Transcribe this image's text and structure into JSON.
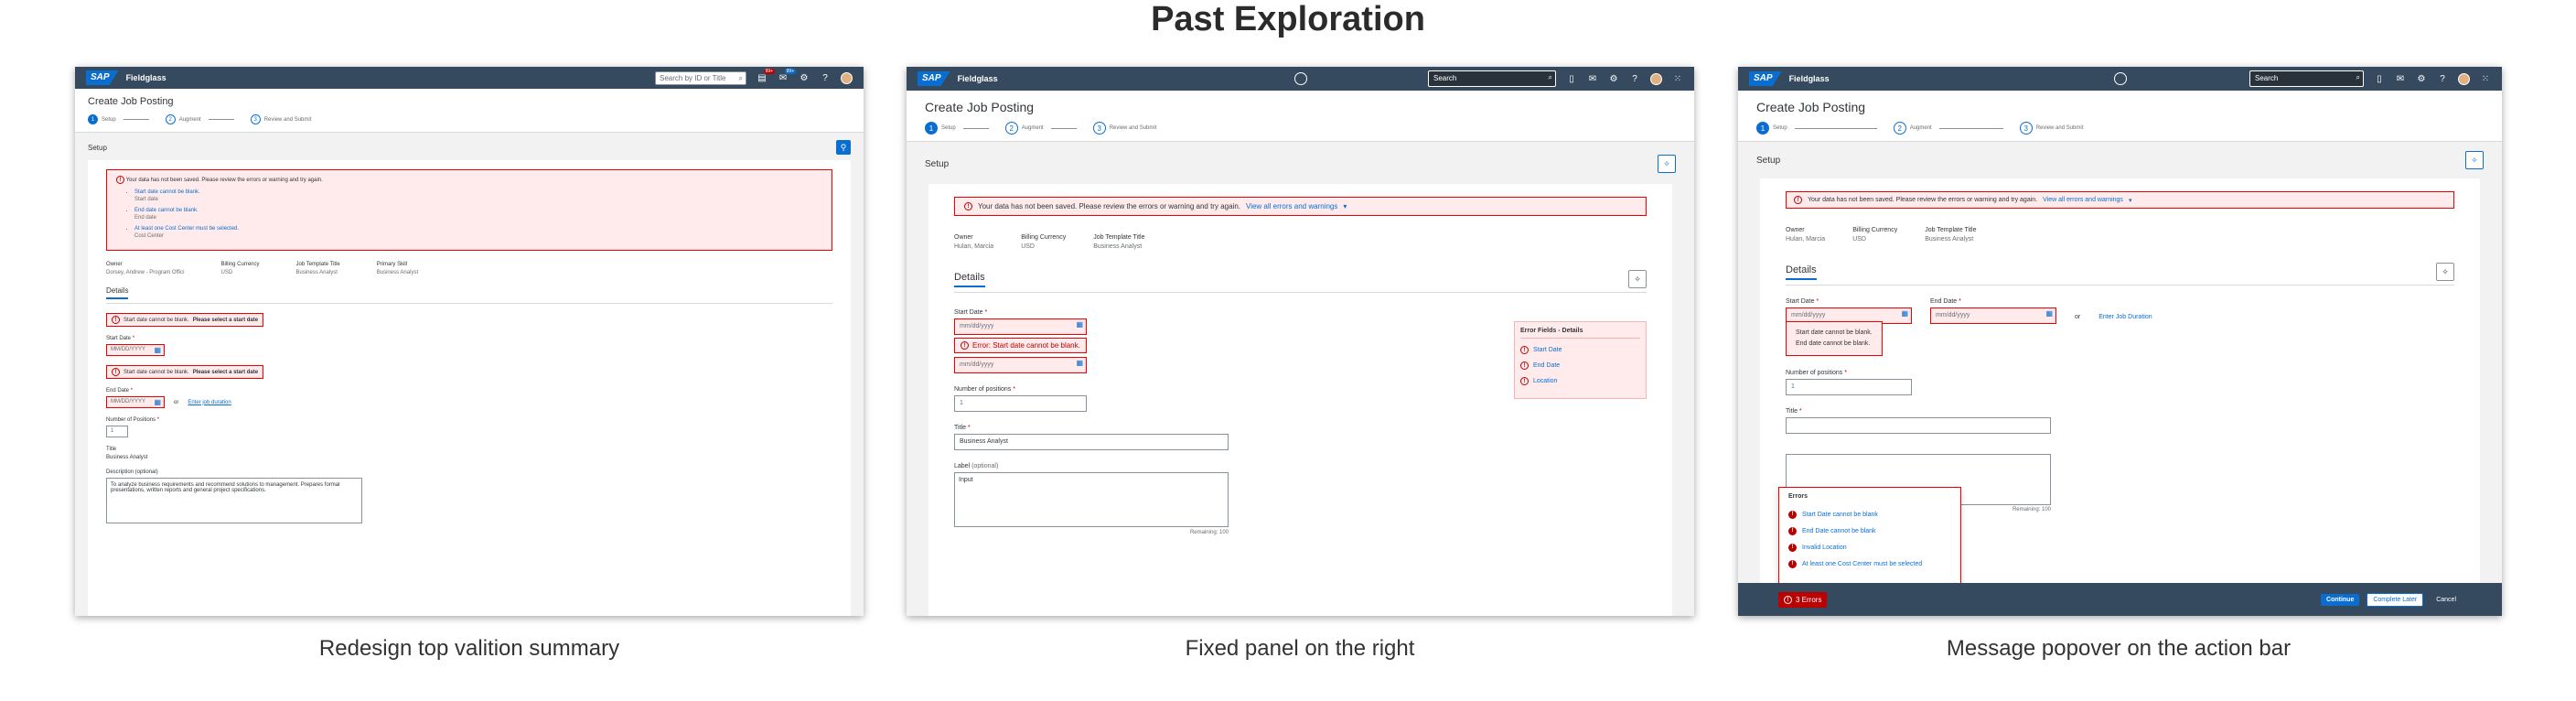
{
  "title": "Past Exploration",
  "common": {
    "sap_logo": "SAP",
    "product": "Fieldglass",
    "page_title": "Create Job Posting",
    "steps": [
      {
        "num": "1",
        "label": "Setup"
      },
      {
        "num": "2",
        "label": "Augment"
      },
      {
        "num": "3",
        "label": "Review and Submit"
      }
    ],
    "section_title": "Setup",
    "details_tab": "Details",
    "search_placeholder": "Search"
  },
  "variant1": {
    "caption": "Redesign top valition summary",
    "search_placeholder": "Search by ID or Title",
    "notif_badge": "99+",
    "msg_badge": "99+",
    "error_header": "Your data has not been saved. Please review the errors or warning and try again.",
    "errors": [
      {
        "text": "Start date cannot be blank.",
        "field": "Start date"
      },
      {
        "text": "End date cannot be blank.",
        "field": "End date"
      },
      {
        "text": "At least one Cost Center must be selected.",
        "field": "Cost Center"
      }
    ],
    "meta": [
      {
        "label": "Owner",
        "value": "Dorsey, Andrew - Program Offici"
      },
      {
        "label": "Billing Currency",
        "value": "USD"
      },
      {
        "label": "Job Template Title",
        "value": "Business Analyst"
      },
      {
        "label": "Primary Skill",
        "value": "Business Analyst"
      }
    ],
    "inline_err_msg": "Start date cannot be blank.",
    "inline_err_hint": "Please select a start date",
    "start_label": "Start Date",
    "end_label": "End Date",
    "date_placeholder": "MM/DD/YYYY",
    "or": "or",
    "enter_duration": "Enter job duration",
    "positions_label": "Number of Positions",
    "positions_value": "1",
    "title_label": "Title",
    "title_value": "Business Analyst",
    "desc_label": "Description (optional)",
    "desc_value": "To analyze business requirements and recommend solutions to management. Prepares formal presentations, written reports and general project specifications."
  },
  "variant2": {
    "caption": "Fixed panel on the right",
    "error_header": "Your data has not been saved. Please review the errors or warning and try again.",
    "view_all": "View all errors and warnings",
    "meta": [
      {
        "label": "Owner",
        "value": "Hulan, Marcia"
      },
      {
        "label": "Billing Currency",
        "value": "USD"
      },
      {
        "label": "Job Template Title",
        "value": "Business Analyst"
      }
    ],
    "start_label": "Start Date",
    "date_placeholder": "mm/dd/yyyy",
    "inline_err": "Error: Start date cannot be blank.",
    "positions_label": "Number of positions",
    "positions_value": "1",
    "title_label": "Title",
    "title_value": "Business Analyst",
    "label_label": "Label",
    "label_optional": "(optional)",
    "label_value": "Input",
    "remaining": "Remaining: 100",
    "panel_title": "Error Fields - Details",
    "panel_items": [
      "Start Date",
      "End Date",
      "Location"
    ]
  },
  "variant3": {
    "caption": "Message popover on the action bar",
    "error_header": "Your data has not been saved. Please review the errors or warning and try again.",
    "view_all": "View all errors and warnings",
    "meta": [
      {
        "label": "Owner",
        "value": "Hulan, Marcia"
      },
      {
        "label": "Billing Currency",
        "value": "USD"
      },
      {
        "label": "Job Template Title",
        "value": "Business Analyst"
      }
    ],
    "start_label": "Start Date",
    "end_label": "End Date",
    "date_placeholder": "mm/dd/yyyy",
    "or": "or",
    "enter_duration": "Enter Job Duration",
    "tip_line1": "Start date cannot be blank.",
    "tip_line2": "End date cannot be blank.",
    "positions_label": "Number of positions",
    "positions_value": "1",
    "title_label": "Title",
    "remaining": "Remaining: 100",
    "popover_title": "Errors",
    "popover_items": [
      "Start Date cannot be blank",
      "End Date cannot be blank",
      "Invalid Location",
      "At least one Cost Center must be selected"
    ],
    "error_button": "3 Errors",
    "continue": "Continue",
    "complete_later": "Complete Later",
    "cancel": "Cancel"
  }
}
